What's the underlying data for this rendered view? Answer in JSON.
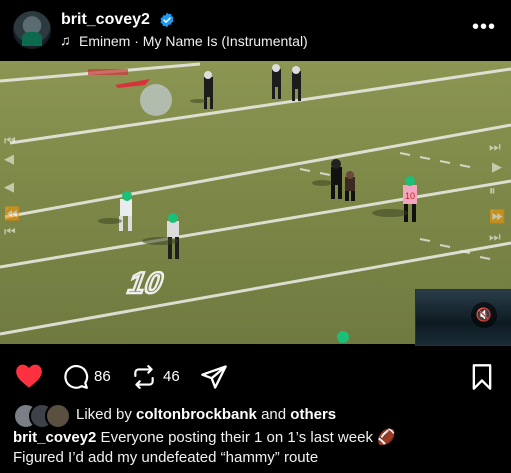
{
  "header": {
    "username": "brit_covey2",
    "verified": true,
    "music_icon": "music-note-icon",
    "song": "Eminem · My Name Is (Instrumental)",
    "more_label": "•••"
  },
  "video": {
    "field_numbers": [
      "10"
    ],
    "jersey_number": "10"
  },
  "actions": {
    "like_icon": "heart-filled-icon",
    "liked": true,
    "comment_count": "86",
    "repost_count": "46",
    "share_icon": "send-icon",
    "save_icon": "bookmark-icon"
  },
  "likes": {
    "prefix": "Liked by ",
    "user": "coltonbrockbank",
    "middle": " and ",
    "suffix": "others"
  },
  "caption": {
    "username": "brit_covey2",
    "line1": " Everyone posting their 1 on 1’s last week 🏈",
    "line2": "Figured I’d add my undefeated “hammy” route"
  },
  "colors": {
    "heart": "#ff3040",
    "verified": "#1d9bf0",
    "field": "#7f8a48"
  }
}
